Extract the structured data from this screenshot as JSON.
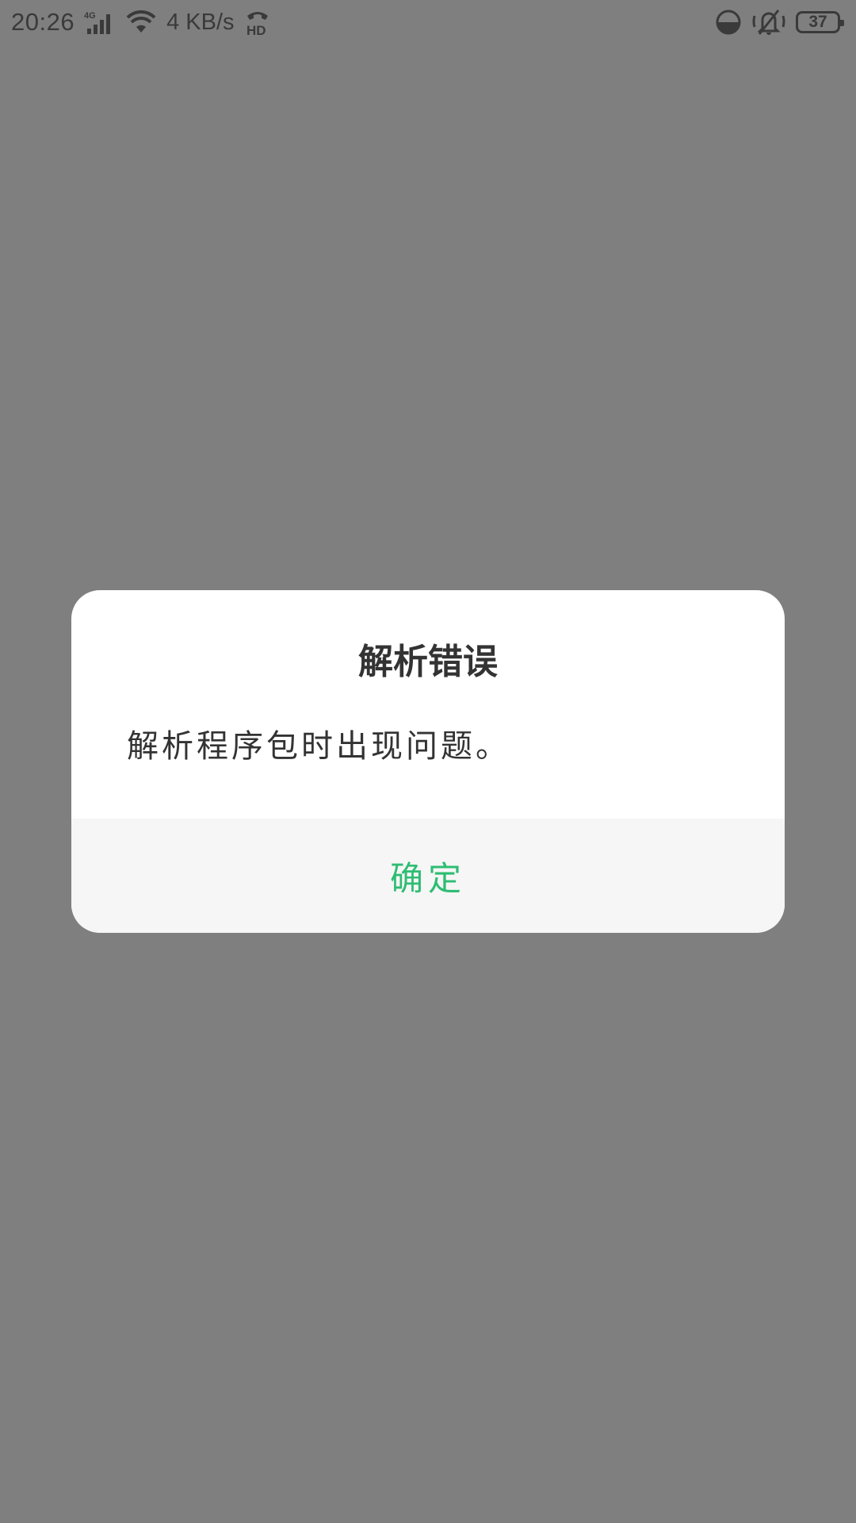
{
  "status_bar": {
    "time": "20:26",
    "network_type": "4G",
    "net_speed": "4 KB/s",
    "hd_label": "HD",
    "battery_level": "37",
    "icons": [
      "signal-icon",
      "wifi-icon",
      "hd-call-icon",
      "theme-icon",
      "silent-icon",
      "battery-icon"
    ]
  },
  "dialog": {
    "title": "解析错误",
    "message": "解析程序包时出现问题。",
    "confirm_label": "确定"
  },
  "colors": {
    "overlay": "#7f7f7f",
    "dialog_bg": "#ffffff",
    "footer_bg": "#f6f6f6",
    "accent": "#2ebd73",
    "text": "#333333"
  }
}
